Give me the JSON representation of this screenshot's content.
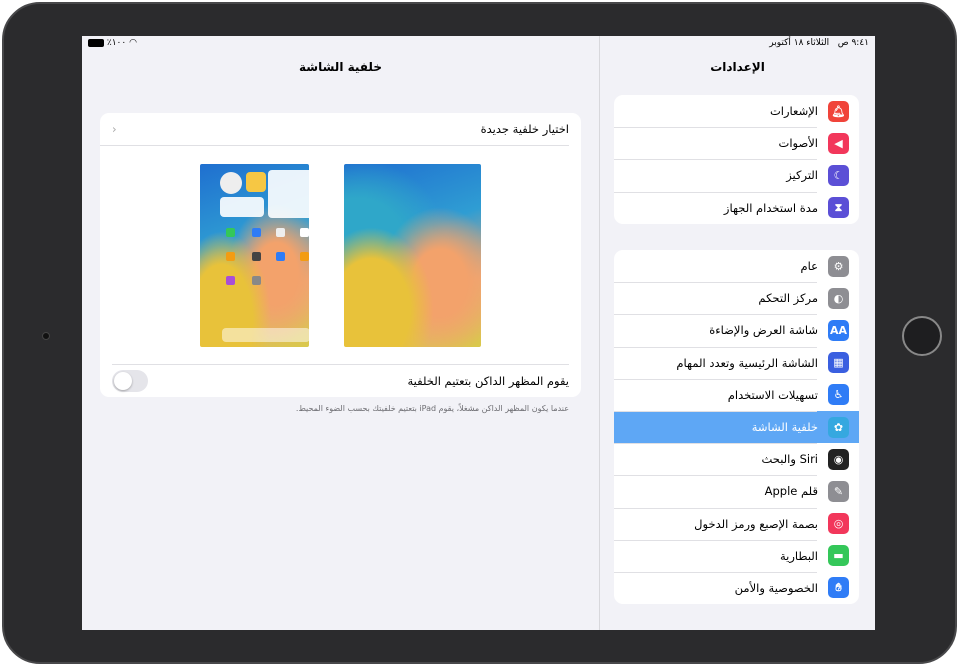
{
  "status": {
    "time": "٩:٤١ ص",
    "date": "الثلاثاء ١٨ أكتوبر",
    "battery": "٪١٠٠"
  },
  "sidebar": {
    "title": "الإعدادات",
    "group1": [
      {
        "label": "الإشعارات",
        "icon": "bell-icon",
        "color": "#f0443a"
      },
      {
        "label": "الأصوات",
        "icon": "speaker-icon",
        "color": "#f2375b"
      },
      {
        "label": "التركيز",
        "icon": "moon-icon",
        "color": "#5b4fd6"
      },
      {
        "label": "مدة استخدام الجهاز",
        "icon": "hourglass-icon",
        "color": "#5b4fd6"
      }
    ],
    "group2": [
      {
        "label": "عام",
        "icon": "gear-icon",
        "color": "#8e8e93"
      },
      {
        "label": "مركز التحكم",
        "icon": "toggles-icon",
        "color": "#8e8e93"
      },
      {
        "label": "شاشة العرض والإضاءة",
        "icon": "text-size-icon",
        "color": "#2f7cf6"
      },
      {
        "label": "الشاشة الرئيسية وتعدد المهام",
        "icon": "grid-icon",
        "color": "#3a5fe0"
      },
      {
        "label": "تسهيلات الاستخدام",
        "icon": "accessibility-icon",
        "color": "#2f7cf6"
      },
      {
        "label": "خلفية الشاشة",
        "icon": "flower-icon",
        "color": "#35a8e0",
        "selected": true
      },
      {
        "label": "Siri والبحث",
        "icon": "siri-icon",
        "color": "#222"
      },
      {
        "label": "قلم Apple",
        "icon": "pencil-icon",
        "color": "#8e8e93"
      },
      {
        "label": "بصمة الإصبع ورمز الدخول",
        "icon": "fingerprint-icon",
        "color": "#f2375b"
      },
      {
        "label": "البطارية",
        "icon": "battery-icon",
        "color": "#34c759"
      },
      {
        "label": "الخصوصية والأمن",
        "icon": "hand-icon",
        "color": "#2f7cf6"
      }
    ]
  },
  "detail": {
    "title": "خلفية الشاشة",
    "choose_label": "اختيار خلفية جديدة",
    "dark_toggle_label": "يقوم المظهر الداكن بتعتيم الخلفية",
    "dark_toggle_on": false,
    "footer": "عندما يكون المظهر الداكن مشغلاً، يقوم iPad بتعتيم خلفيتك بحسب الضوء المحيط."
  }
}
